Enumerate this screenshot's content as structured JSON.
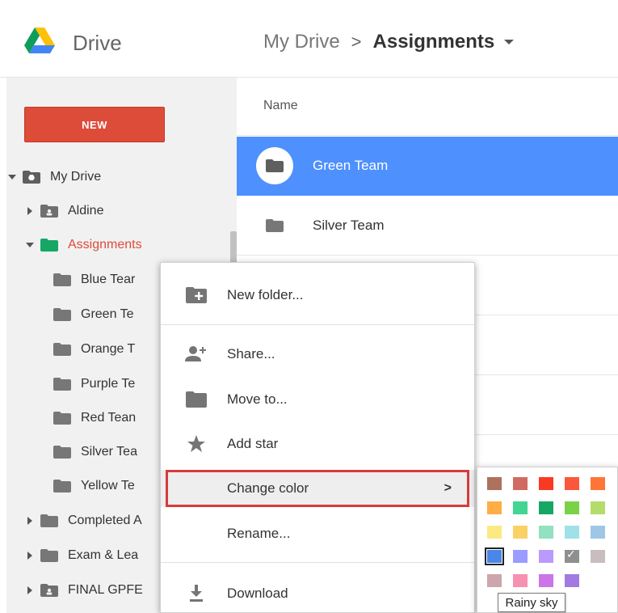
{
  "header": {
    "app_title": "Drive",
    "breadcrumb": {
      "root": "My Drive",
      "separator": ">",
      "current": "Assignments"
    }
  },
  "sidebar": {
    "new_label": "NEW",
    "tree": [
      {
        "label": "My Drive",
        "expanded": true,
        "icon": "drive-folder-icon"
      },
      {
        "label": "Aldine",
        "expanded": false,
        "icon": "shared-folder-icon"
      },
      {
        "label": "Assignments",
        "expanded": true,
        "icon": "green-folder-icon",
        "active": true
      },
      {
        "label": "Blue Tear",
        "icon": "folder-icon"
      },
      {
        "label": "Green Te",
        "icon": "folder-icon"
      },
      {
        "label": "Orange T",
        "icon": "folder-icon"
      },
      {
        "label": "Purple Te",
        "icon": "folder-icon"
      },
      {
        "label": "Red Tean",
        "icon": "folder-icon"
      },
      {
        "label": "Silver Tea",
        "icon": "folder-icon"
      },
      {
        "label": "Yellow Te",
        "icon": "folder-icon"
      },
      {
        "label": "Completed A",
        "expanded": false,
        "icon": "folder-icon"
      },
      {
        "label": "Exam & Lea",
        "expanded": false,
        "icon": "folder-icon"
      },
      {
        "label": "FINAL GPFE",
        "expanded": false,
        "icon": "shared-folder-icon"
      }
    ]
  },
  "file_list": {
    "column_name": "Name",
    "rows": [
      {
        "name": "Green Team",
        "selected": true
      },
      {
        "name": "Silver Team",
        "selected": false
      }
    ]
  },
  "context_menu": {
    "items": [
      {
        "label": "New folder...",
        "icon": "new-folder-icon"
      },
      {
        "label": "Share...",
        "icon": "add-person-icon"
      },
      {
        "label": "Move to...",
        "icon": "folder-icon"
      },
      {
        "label": "Add star",
        "icon": "star-icon"
      },
      {
        "label": "Change color",
        "icon": "",
        "submenu_arrow": ">"
      },
      {
        "label": "Rename...",
        "icon": ""
      },
      {
        "label": "Download",
        "icon": "download-icon"
      }
    ]
  },
  "color_palette": {
    "colors": [
      [
        "#ac725e",
        "#d06b64",
        "#f83a22",
        "#fa573c",
        "#ff7537"
      ],
      [
        "#ffad46",
        "#42d692",
        "#16a765",
        "#7bd148",
        "#b3dc6c"
      ],
      [
        "#fbe983",
        "#fad165",
        "#92e1c0",
        "#9fe1e7",
        "#9fc6e7"
      ],
      [
        "#4986e7",
        "#9a9cff",
        "#b99aff",
        "#8f8f8f",
        "#cabdbf"
      ],
      [
        "#cca6ac",
        "#f691b2",
        "#cd74e6",
        "#a47ae2"
      ]
    ],
    "selected_color": "#4986e7",
    "checked_color": "#8f8f8f",
    "tooltip": "Rainy sky"
  },
  "colors": {
    "accent_red": "#dd4b39",
    "selection_blue": "#4d90fe"
  }
}
